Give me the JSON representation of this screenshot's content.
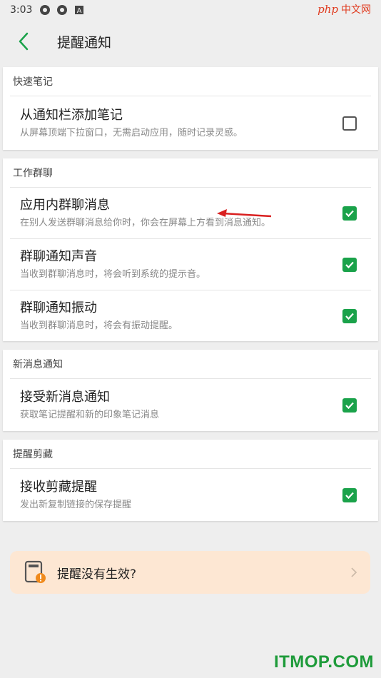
{
  "status_bar": {
    "time": "3:03"
  },
  "watermark": {
    "php": "php",
    "cn": "中文网",
    "site": "ITMOP.COM"
  },
  "app_bar": {
    "title": "提醒通知"
  },
  "sections": [
    {
      "header": "快速笔记",
      "items": [
        {
          "title": "从通知栏添加笔记",
          "subtitle": "从屏幕顶端下拉窗口，无需启动应用，随时记录灵感。",
          "checked": false
        }
      ]
    },
    {
      "header": "工作群聊",
      "items": [
        {
          "title": "应用内群聊消息",
          "subtitle": "在别人发送群聊消息给你时，你会在屏幕上方看到消息通知。",
          "checked": true
        },
        {
          "title": "群聊通知声音",
          "subtitle": "当收到群聊消息时，将会听到系统的提示音。",
          "checked": true
        },
        {
          "title": "群聊通知振动",
          "subtitle": "当收到群聊消息时，将会有振动提醒。",
          "checked": true
        }
      ]
    },
    {
      "header": "新消息通知",
      "items": [
        {
          "title": "接受新消息通知",
          "subtitle": "获取笔记提醒和新的印象笔记消息",
          "checked": true
        }
      ]
    },
    {
      "header": "提醒剪藏",
      "items": [
        {
          "title": "接收剪藏提醒",
          "subtitle": "发出新复制链接的保存提醒",
          "checked": true
        }
      ]
    }
  ],
  "help_card": {
    "label": "提醒没有生效?"
  },
  "colors": {
    "accent": "#1aa24a",
    "help_bg": "#fde7d3",
    "annotation_arrow": "#d92020"
  }
}
